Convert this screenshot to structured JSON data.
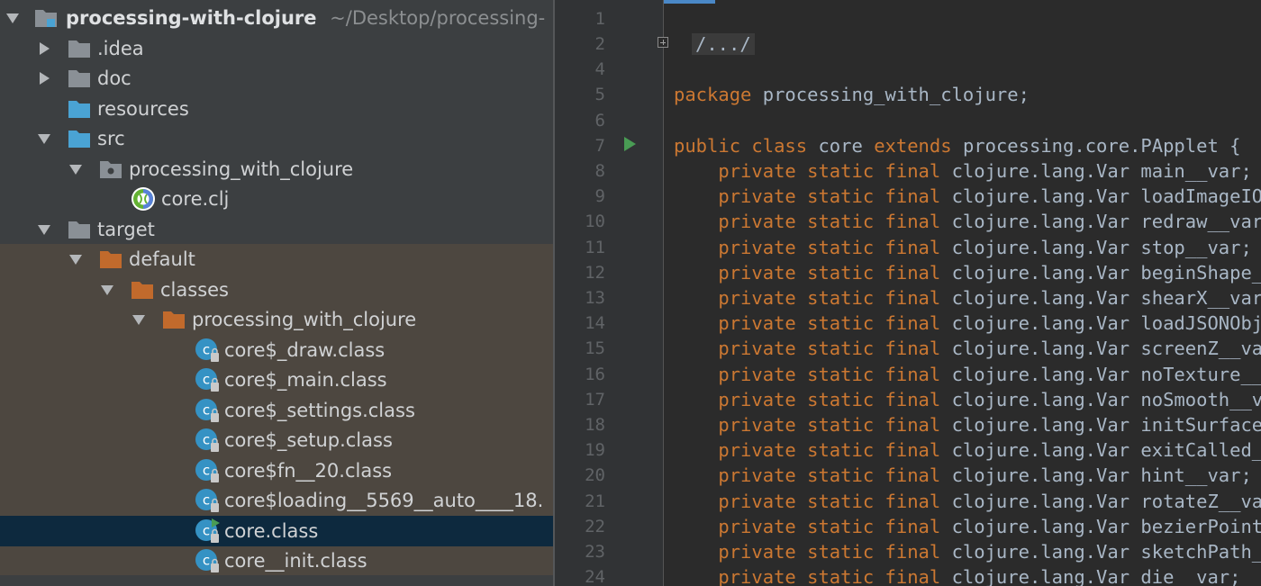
{
  "project_tree": {
    "root": {
      "name": "processing-with-clojure",
      "path": "~/Desktop/processing-"
    },
    "items": [
      {
        "label": "processing-with-clojure"
      },
      {
        "label": ".idea"
      },
      {
        "label": "doc"
      },
      {
        "label": "resources"
      },
      {
        "label": "src"
      },
      {
        "label": "processing_with_clojure"
      },
      {
        "label": "core.clj"
      },
      {
        "label": "target"
      },
      {
        "label": "default"
      },
      {
        "label": "classes"
      },
      {
        "label": "processing_with_clojure"
      },
      {
        "label": "core$_draw.class"
      },
      {
        "label": "core$_main.class"
      },
      {
        "label": "core$_settings.class"
      },
      {
        "label": "core$_setup.class"
      },
      {
        "label": "core$fn__20.class"
      },
      {
        "label": "core$loading__5569__auto____18."
      },
      {
        "label": "core.class"
      },
      {
        "label": "core__init.class"
      }
    ],
    "selected_index": 17
  },
  "editor": {
    "line_numbers": [
      "1",
      "2",
      "4",
      "5",
      "6",
      "7",
      "8",
      "9",
      "10",
      "11",
      "12",
      "13",
      "14",
      "15",
      "16",
      "17",
      "18",
      "19",
      "20",
      "21",
      "22",
      "23",
      "24"
    ],
    "folded_text": "/.../",
    "package_keyword": "package",
    "package_name": "processing_with_clojure;",
    "class_decl": {
      "kw_public": "public",
      "kw_class": "class",
      "name": "core",
      "kw_extends": "extends",
      "parent": "processing.core.PApplet {"
    },
    "field_modifiers": "private static final",
    "field_type": "clojure.lang.Var",
    "fields": [
      "main__var;",
      "loadImageIO",
      "redraw__var",
      "stop__var;",
      "beginShape_",
      "shearX__var",
      "loadJSONObj",
      "screenZ__va",
      "noTexture__",
      "noSmooth__v",
      "initSurface",
      "exitCalled_",
      "hint__var;",
      "rotateZ__va",
      "bezierPoint",
      "sketchPath_",
      "die__var;"
    ]
  },
  "colors": {
    "keyword": "#cc7832",
    "plain": "#a9b7c6",
    "selection": "#0d293e",
    "excluded_bg": "#4d4740",
    "folder_gray": "#8a9096",
    "folder_blue": "#4aa3d4",
    "folder_orange": "#c16a2c",
    "run": "#499c54"
  }
}
